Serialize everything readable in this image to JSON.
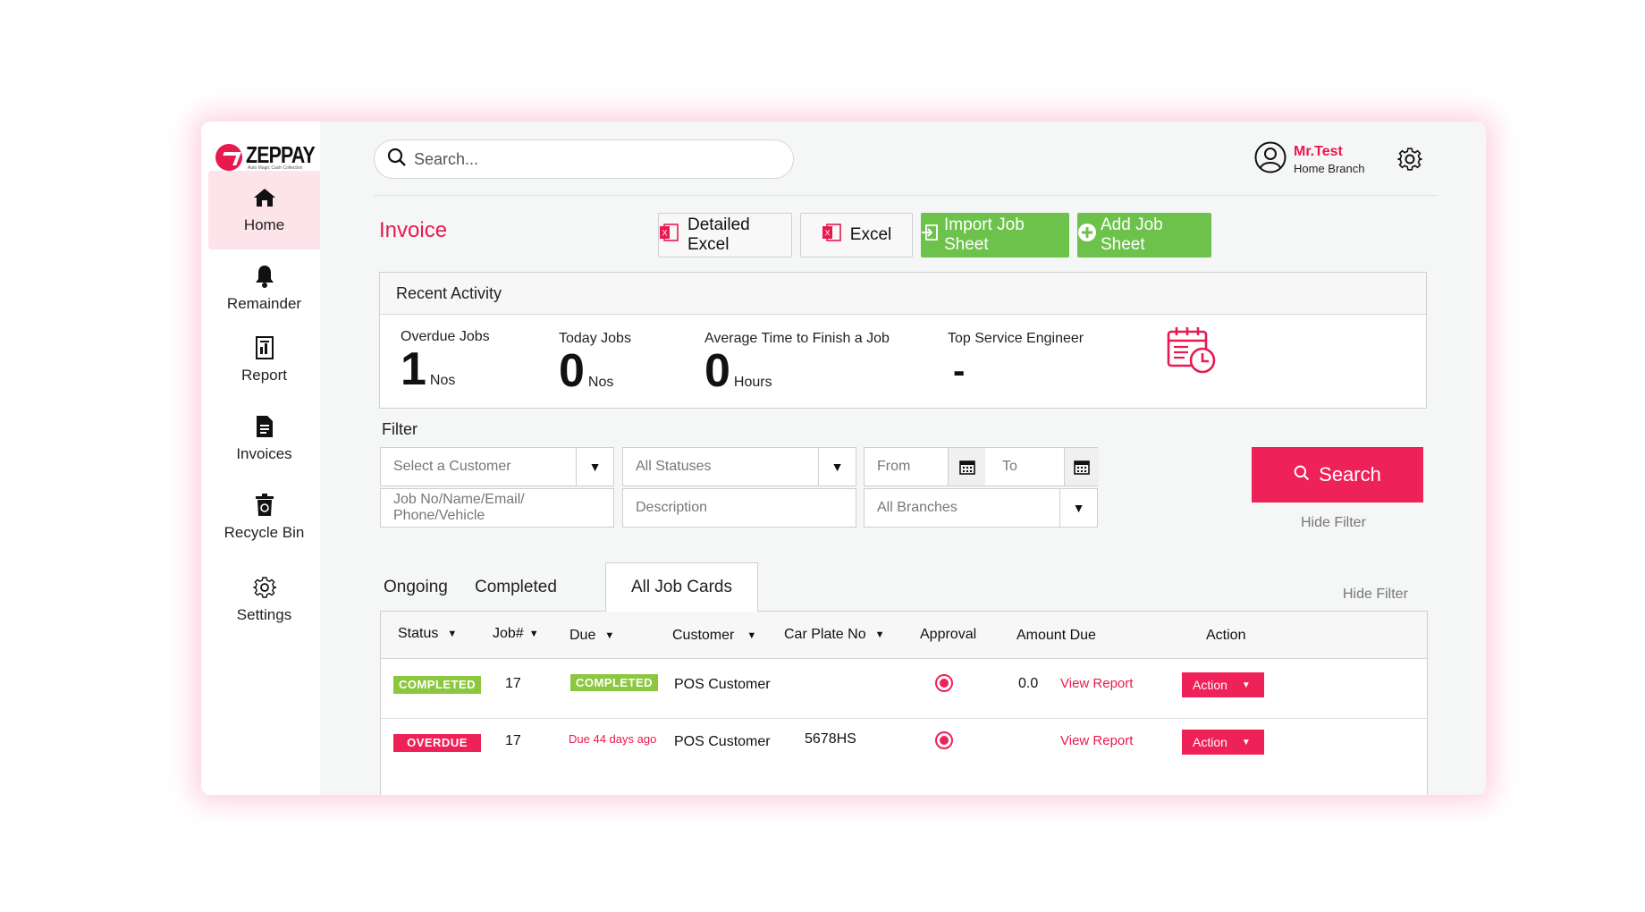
{
  "app": {
    "logo_name": "ZEPPAY",
    "logo_tagline": "Auto Magic Cash Collection",
    "brand_color": "#e8194f",
    "success_color": "#6cc24a"
  },
  "sidebar": {
    "items": [
      {
        "label": "Home",
        "icon": "home-icon",
        "active": true
      },
      {
        "label": "Remainder",
        "icon": "bell-icon"
      },
      {
        "label": "Report",
        "icon": "report-icon"
      },
      {
        "label": "Invoices",
        "icon": "invoice-icon"
      },
      {
        "label": "Recycle Bin",
        "icon": "recycle-bin-icon"
      },
      {
        "label": "Settings",
        "icon": "gear-icon"
      }
    ]
  },
  "header": {
    "search_placeholder": "Search...",
    "user_name": "Mr.Test",
    "user_branch": "Home Branch"
  },
  "page": {
    "title": "Invoice",
    "buttons": {
      "detailed_excel": "Detailed Excel",
      "excel": "Excel",
      "import_job_sheet": "Import Job Sheet",
      "add_job_sheet": "Add Job Sheet"
    }
  },
  "activity": {
    "heading": "Recent Activity",
    "stats": [
      {
        "label": "Overdue Jobs",
        "value": "1",
        "unit": "Nos"
      },
      {
        "label": "Today Jobs",
        "value": "0",
        "unit": "Nos"
      },
      {
        "label": "Average Time to Finish a Job",
        "value": "0",
        "unit": "Hours"
      },
      {
        "label": "Top Service Engineer",
        "value": "-",
        "unit": ""
      }
    ]
  },
  "filter": {
    "label": "Filter",
    "customer_placeholder": "Select a Customer",
    "status_placeholder": "All Statuses",
    "from_placeholder": "From",
    "to_placeholder": "To",
    "job_placeholder": "Job No/Name/Email/ Phone/Vehicle",
    "description_placeholder": "Description",
    "branch_placeholder": "All Branches",
    "search_label": "Search",
    "hide_filter": "Hide Filter"
  },
  "tabs": {
    "ongoing": "Ongoing",
    "completed": "Completed",
    "all_job_cards": "All Job Cards",
    "hide_filter": "Hide Filter"
  },
  "table": {
    "headers": {
      "status": "Status",
      "job": "Job#",
      "due": "Due",
      "customer": "Customer",
      "car_plate": "Car Plate No",
      "approval": "Approval",
      "amount_due": "Amount Due",
      "action": "Action"
    },
    "rows": [
      {
        "status": "COMPLETED",
        "job": "17",
        "due": "COMPLETED",
        "customer": "POS Customer",
        "car_plate": "",
        "amount_due": "0.0",
        "report_link": "View Report",
        "action": "Action"
      },
      {
        "status": "OVERDUE",
        "job": "17",
        "due": "Due 44 days ago",
        "customer": "POS Customer",
        "car_plate": "5678HS",
        "amount_due": "",
        "report_link": "View Report",
        "action": "Action"
      }
    ]
  }
}
